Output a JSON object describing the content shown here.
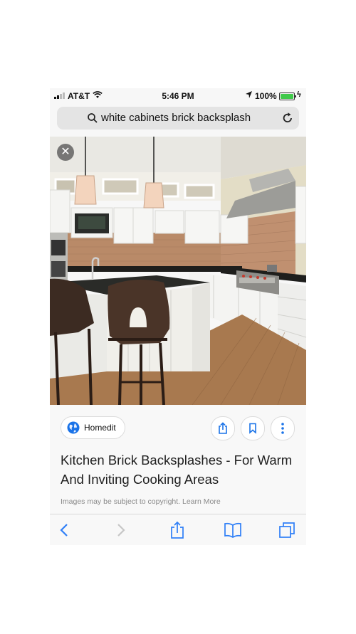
{
  "status_bar": {
    "carrier": "AT&T",
    "time": "5:46 PM",
    "battery": "100%"
  },
  "url_bar": {
    "query": "white cabinets brick backsplash"
  },
  "result": {
    "source": "Homedit",
    "title": "Kitchen Brick Backsplashes - For Warm And Inviting Cooking Areas",
    "copyright": "Images may be subject to copyright. Learn More"
  },
  "colors": {
    "accent": "#1a73e8",
    "safari_blue": "#2f7ff7",
    "battery_green": "#3fc94a"
  },
  "icons": [
    "search-icon",
    "reload-icon",
    "close-icon",
    "globe-icon",
    "share-icon",
    "bookmark-icon",
    "more-icon",
    "back-icon",
    "forward-icon",
    "book-icon",
    "tabs-icon"
  ]
}
